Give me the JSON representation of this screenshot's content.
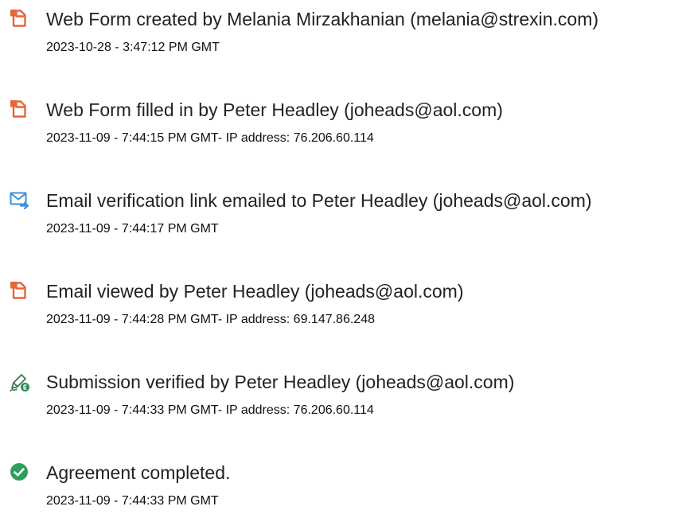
{
  "events": [
    {
      "icon": "document-orange-icon",
      "title": "Web Form created by Melania Mirzakhanian (melania@strexin.com)",
      "meta": "2023-10-28 - 3:47:12 PM GMT"
    },
    {
      "icon": "document-orange-icon",
      "title": "Web Form filled in by Peter Headley (joheads@aol.com)",
      "meta": "2023-11-09 - 7:44:15 PM GMT- IP address: 76.206.60.114"
    },
    {
      "icon": "email-send-icon",
      "title": "Email verification link emailed to Peter Headley (joheads@aol.com)",
      "meta": "2023-11-09 - 7:44:17 PM GMT"
    },
    {
      "icon": "document-orange-icon",
      "title": "Email viewed by Peter Headley (joheads@aol.com)",
      "meta": "2023-11-09 - 7:44:28 PM GMT- IP address: 69.147.86.248"
    },
    {
      "icon": "pen-verified-icon",
      "title": "Submission verified by Peter Headley (joheads@aol.com)",
      "meta": "2023-11-09 - 7:44:33 PM GMT- IP address: 76.206.60.114"
    },
    {
      "icon": "check-circle-icon",
      "title": "Agreement completed.",
      "meta": "2023-11-09 - 7:44:33 PM GMT"
    }
  ],
  "colors": {
    "document_icon": "#e8643c",
    "email_icon": "#3f8fd6",
    "pen_icon": "#2e8b57",
    "check_icon": "#2f9e5c"
  }
}
